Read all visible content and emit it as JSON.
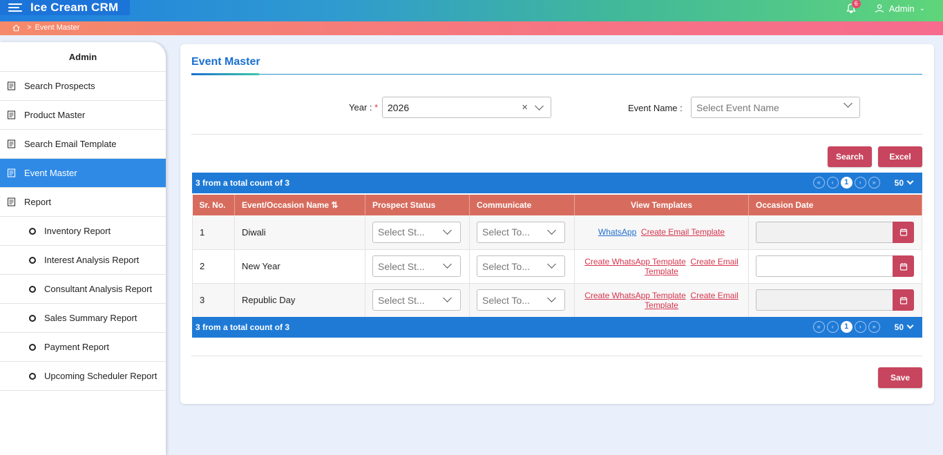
{
  "header": {
    "app_title": "Ice Cream CRM",
    "notification_count": "6",
    "user_name": "Admin"
  },
  "breadcrumb": {
    "current": "Event Master"
  },
  "sidebar": {
    "heading": "Admin",
    "items": [
      {
        "label": "Search Prospects"
      },
      {
        "label": "Product Master"
      },
      {
        "label": "Search Email Template"
      },
      {
        "label": "Event Master"
      },
      {
        "label": "Report"
      }
    ],
    "sub_items": [
      {
        "label": "Inventory Report"
      },
      {
        "label": "Interest Analysis Report"
      },
      {
        "label": "Consultant Analysis Report"
      },
      {
        "label": "Sales Summary Report"
      },
      {
        "label": "Payment Report"
      },
      {
        "label": "Upcoming Scheduler Report"
      }
    ]
  },
  "page": {
    "title": "Event Master"
  },
  "filters": {
    "year_label": "Year :",
    "year_required": "*",
    "year_value": "2026",
    "event_label": "Event Name :",
    "event_placeholder": "Select Event Name"
  },
  "buttons": {
    "search": "Search",
    "excel": "Excel",
    "save": "Save"
  },
  "pager": {
    "count_text": "3 from a total count of 3",
    "current_page": "1",
    "page_size": "50"
  },
  "table": {
    "columns": [
      "Sr. No.",
      "Event/Occasion Name",
      "Prospect Status",
      "Communicate",
      "View Templates",
      "Occasion Date"
    ],
    "status_placeholder": "Select St...",
    "communicate_placeholder": "Select To...",
    "rows": [
      {
        "sr": "1",
        "name": "Diwali",
        "whatsapp": "WhatsApp",
        "email": "Create Email Template"
      },
      {
        "sr": "2",
        "name": "New Year",
        "whatsapp": "Create WhatsApp Template",
        "email": "Create Email Template"
      },
      {
        "sr": "3",
        "name": "Republic Day",
        "whatsapp": "Create WhatsApp Template",
        "email": "Create Email Template"
      }
    ]
  },
  "colors": {
    "primary": "#1f7ad6",
    "accent": "#c7455e",
    "header_row": "#d76c5e"
  }
}
